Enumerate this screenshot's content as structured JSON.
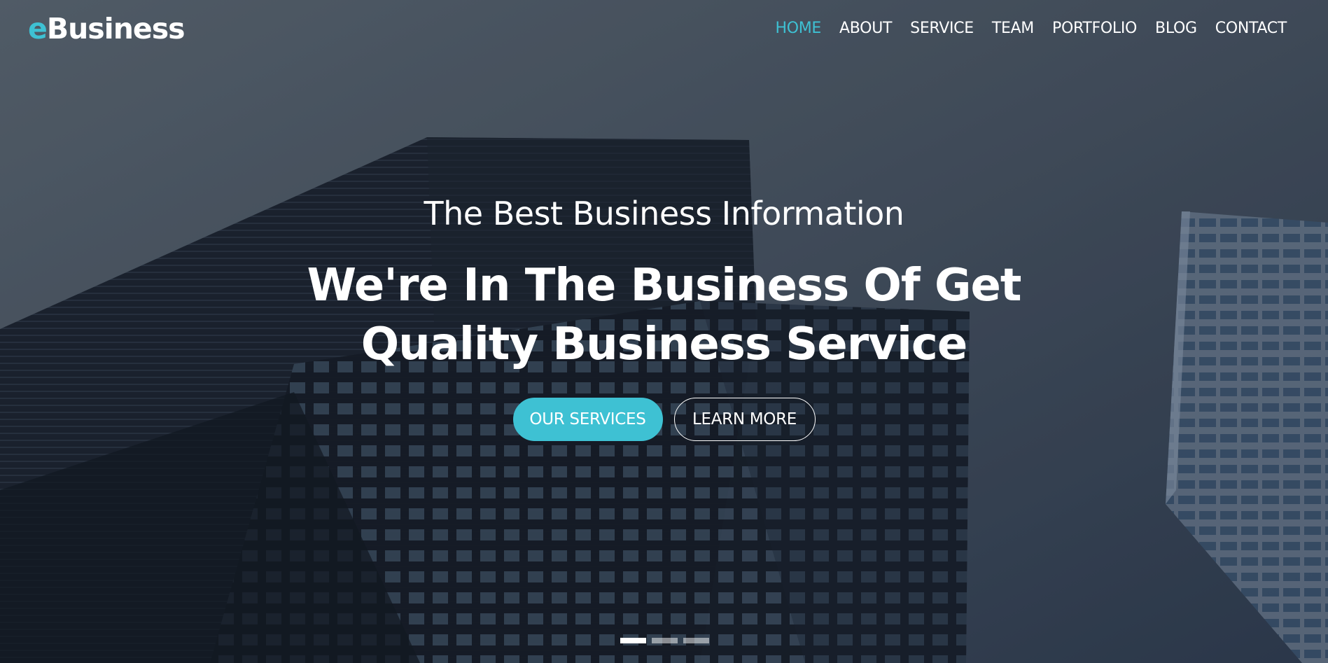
{
  "header": {
    "logo_accent": "e",
    "logo_rest": "Business",
    "nav": [
      {
        "label": "HOME",
        "active": true
      },
      {
        "label": "ABOUT",
        "active": false
      },
      {
        "label": "SERVICE",
        "active": false
      },
      {
        "label": "TEAM",
        "active": false
      },
      {
        "label": "PORTFOLIO",
        "active": false
      },
      {
        "label": "BLOG",
        "active": false
      },
      {
        "label": "CONTACT",
        "active": false
      }
    ]
  },
  "hero": {
    "subtitle": "The Best Business Information",
    "headline": "We're In The Business Of Get Quality Business Service",
    "primary_button": "OUR SERVICES",
    "secondary_button": "LEARN MORE"
  },
  "slider": {
    "slides": 3,
    "active_index": 0
  },
  "colors": {
    "accent": "#3ec1d3",
    "text": "#ffffff"
  }
}
